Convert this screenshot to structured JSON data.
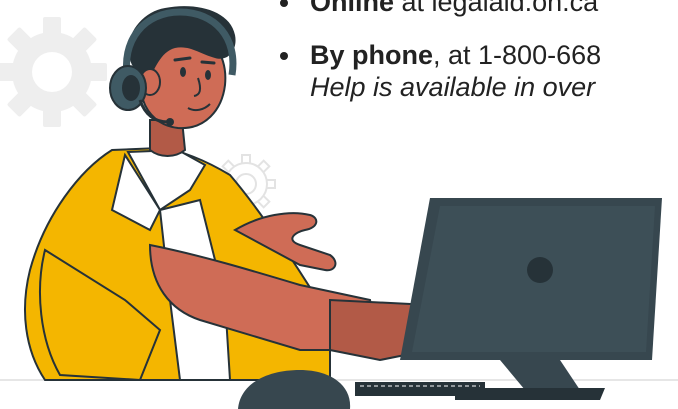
{
  "contact_options": [
    {
      "method": "Online",
      "detail": " at legalaid.on.ca"
    },
    {
      "method": "By phone",
      "detail": ", at 1-800-668",
      "note": "Help is available in over"
    }
  ],
  "colors": {
    "skin": "#cf6c56",
    "skin_dark": "#b25a47",
    "hair": "#263238",
    "jacket": "#f4b600",
    "shirt": "#ffffff",
    "headset": "#3f5a64",
    "monitor": "#37474f",
    "gear": "#e6e6e6",
    "text": "#222222"
  },
  "icons": [
    "gear-icon",
    "headset-icon",
    "monitor-icon",
    "mouse-icon",
    "keyboard-icon"
  ]
}
